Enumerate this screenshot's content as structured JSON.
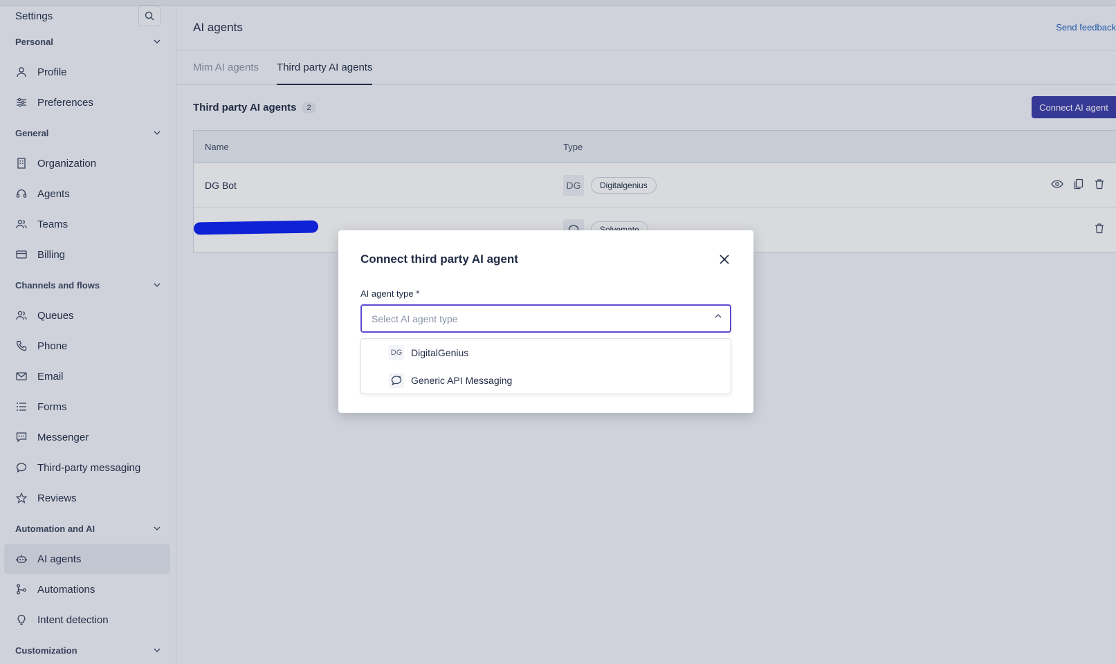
{
  "sidebar": {
    "title": "Settings",
    "sections": [
      {
        "label": "Personal",
        "items": [
          {
            "label": "Profile",
            "icon": "user-icon"
          },
          {
            "label": "Preferences",
            "icon": "sliders-icon"
          }
        ]
      },
      {
        "label": "General",
        "items": [
          {
            "label": "Organization",
            "icon": "building-icon"
          },
          {
            "label": "Agents",
            "icon": "headset-icon"
          },
          {
            "label": "Teams",
            "icon": "users-icon"
          },
          {
            "label": "Billing",
            "icon": "credit-card-icon"
          }
        ]
      },
      {
        "label": "Channels and flows",
        "items": [
          {
            "label": "Queues",
            "icon": "queue-icon"
          },
          {
            "label": "Phone",
            "icon": "phone-icon"
          },
          {
            "label": "Email",
            "icon": "mail-icon"
          },
          {
            "label": "Forms",
            "icon": "list-icon"
          },
          {
            "label": "Messenger",
            "icon": "chat-icon"
          },
          {
            "label": "Third-party messaging",
            "icon": "chat-bubble-icon"
          },
          {
            "label": "Reviews",
            "icon": "star-icon"
          }
        ]
      },
      {
        "label": "Automation and AI",
        "items": [
          {
            "label": "AI agents",
            "icon": "robot-icon",
            "active": true
          },
          {
            "label": "Automations",
            "icon": "flow-icon"
          },
          {
            "label": "Intent detection",
            "icon": "bulb-icon"
          }
        ]
      },
      {
        "label": "Customization"
      }
    ]
  },
  "header": {
    "title": "AI agents",
    "feedback": "Send feedback"
  },
  "tabs": [
    {
      "label": "Mim AI agents"
    },
    {
      "label": "Third party AI agents",
      "active": true
    }
  ],
  "list": {
    "title": "Third party AI agents",
    "count": "2",
    "connect_button": "Connect AI agent",
    "columns": [
      "Name",
      "Type"
    ],
    "rows": [
      {
        "name": "DG Bot",
        "type_logo": "DG",
        "type": "Digitalgenius"
      },
      {
        "name": "",
        "type": "Solvemate"
      }
    ]
  },
  "modal": {
    "title": "Connect third party AI agent",
    "field_label": "AI agent type *",
    "placeholder": "Select AI agent type",
    "options": [
      {
        "label": "DigitalGenius",
        "logo": "DG"
      },
      {
        "label": "Generic API Messaging",
        "icon": "chat-bubble-icon"
      }
    ]
  },
  "colors": {
    "accent": "#3a3aa8",
    "focus": "#5b4bd1",
    "link": "#1f5fbf"
  }
}
